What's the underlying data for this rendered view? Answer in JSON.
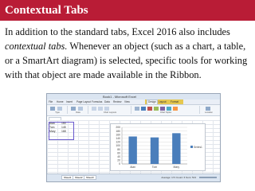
{
  "slide": {
    "title": "Contextual Tabs",
    "text_1": "In addition to the standard tabs, Excel 2016 also includes ",
    "text_em": "contextual tabs.",
    "text_2": " Whenever an object (such as a chart, a table, or a SmartArt diagram) is selected, specific tools for working with that object are made available in the Ribbon.",
    "accent_color": "#b91c36"
  },
  "screenshot": {
    "window_title": "Book1 - Microsoft Excel",
    "tabs": [
      "File",
      "Home",
      "Insert",
      "Page Layout",
      "Formulas",
      "Data",
      "Review",
      "View",
      "Design",
      "Layout",
      "Format"
    ],
    "active_tab": "Design",
    "ribbon_groups": [
      "Type",
      "Data",
      "Chart Layouts",
      "Chart Styles",
      "Location"
    ],
    "table": [
      {
        "label": "Alan",
        "value": "150"
      },
      {
        "label": "Tom",
        "value": "145"
      },
      {
        "label": "Mary",
        "value": "168"
      }
    ],
    "sheet_tabs": [
      "Sheet1",
      "Sheet2",
      "Sheet3"
    ],
    "status_info": "Average: 171  Count: 6  Sum: 513"
  },
  "chart_data": {
    "type": "bar",
    "categories": [
      "Alan",
      "Tom",
      "Mary"
    ],
    "series": [
      {
        "name": "Series1",
        "values": [
          150,
          145,
          168
        ]
      }
    ],
    "ylim": [
      0,
      200
    ],
    "yticks": [
      0,
      20,
      40,
      60,
      80,
      100,
      120,
      140,
      160,
      180,
      200
    ],
    "color": "#4a7ebb",
    "legend_position": "right",
    "grid": true
  }
}
